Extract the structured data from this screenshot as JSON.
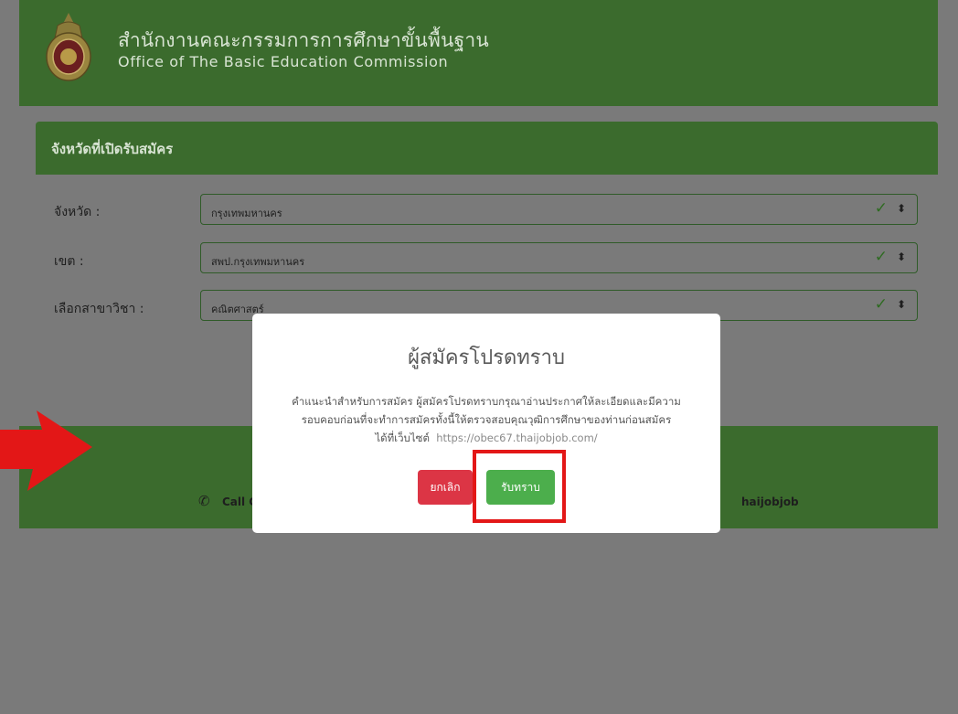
{
  "header": {
    "org_name_th": "สำนักงานคณะกรรมการการศึกษาขั้นพื้นฐาน",
    "org_name_en": "Office of The Basic Education Commission",
    "logo_icon": "obec-emblem-icon"
  },
  "card": {
    "title": "จังหวัดที่เปิดรับสมัคร",
    "rows": [
      {
        "label": "จังหวัด :",
        "value": "กรุงเทพมหานคร"
      },
      {
        "label": "เขต :",
        "value": "สพป.กรุงเทพมหานคร"
      },
      {
        "label": "เลือกสาขาวิชา :",
        "value": "คณิตศาสตร์"
      }
    ]
  },
  "footer": {
    "call_label": "Call C",
    "social_label": "haijobjob",
    "phone_icon": "phone-icon"
  },
  "modal": {
    "title": "ผู้สมัครโปรดทราบ",
    "body_line1": "คำแนะนำสำหรับการสมัคร ผู้สมัครโปรดทราบกรุณาอ่านประกาศให้ละเอียดและมีความ",
    "body_line2": "รอบคอบก่อนที่จะทำการสมัครทั้งนี้ให้ตรวจสอบคุณวุฒิการศึกษาของท่านก่อนสมัคร",
    "body_line3_prefix": "ได้ที่เว็บไซต์",
    "body_link": "https://obec67.thaijobjob.com/",
    "cancel_label": "ยกเลิก",
    "confirm_label": "รับทราบ"
  },
  "colors": {
    "brand_green": "#4a8a3a",
    "cancel_red": "#dc3545",
    "confirm_green": "#4cae4c",
    "annotation_red": "#e31717"
  }
}
